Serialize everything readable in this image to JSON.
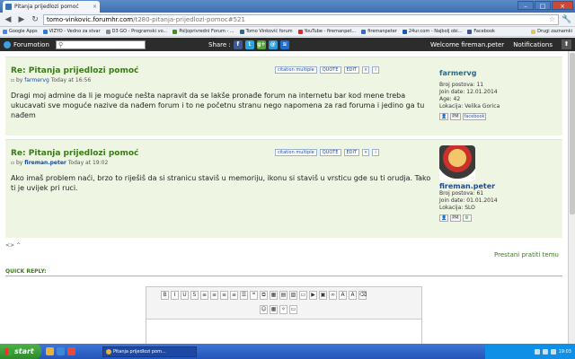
{
  "browser": {
    "tab_title": "Pitanja prijedlozi pomoć",
    "tab_close": "×",
    "controls": {
      "minimize": "–",
      "maximize": "□",
      "close": "×"
    },
    "nav": {
      "back": "◀",
      "forward": "▶",
      "reload": "↻"
    },
    "url_host": "tomo-vinkovic.forumhr.com",
    "url_path": "/t280-pitanja-prijedlozi-pomoc#521",
    "star": "☆",
    "wrench": "🔧"
  },
  "bookmarks": [
    {
      "label": "Google Apps",
      "color": "#4285f4"
    },
    {
      "label": "VIZYO - Vedno za stvar",
      "color": "#2f7bd6"
    },
    {
      "label": "D3 GO - Programski vo...",
      "color": "#888888"
    },
    {
      "label": "Poljoprivredni Forum - ...",
      "color": "#4a8a2a"
    },
    {
      "label": "Tomo Vinković forum",
      "color": "#2a6a8a"
    },
    {
      "label": "YouTube - firemanpet...",
      "color": "#d92b2b"
    },
    {
      "label": "firemanpeter",
      "color": "#3a6ac8"
    },
    {
      "label": "24ur.com - Najbolj obi...",
      "color": "#1a5ab0"
    },
    {
      "label": "Facebook",
      "color": "#3b5998"
    }
  ],
  "bookmarks_other": "Drugi zaznamki",
  "forumotion": {
    "logo": "Forumotion",
    "search_icon": "⚲",
    "share_label": "Share :",
    "welcome": "Welcome fireman.peter",
    "notifications": "Notifications",
    "up_arrow": "⬆"
  },
  "social": [
    {
      "name": "facebook-icon",
      "glyph": "f",
      "color": "#3b5998"
    },
    {
      "name": "twitter-icon",
      "glyph": "t",
      "color": "#28a6e0"
    },
    {
      "name": "google-plus-icon",
      "glyph": "g+",
      "color": "#56a53a"
    },
    {
      "name": "email-icon",
      "glyph": "@",
      "color": "#2c9ad6"
    },
    {
      "name": "rss-icon",
      "glyph": "≋",
      "color": "#1b6ed6"
    }
  ],
  "post_buttons": {
    "citation": "citation multiple",
    "quote": "QUOTE",
    "edit": "EDIT",
    "delete": "×",
    "ip": "i"
  },
  "posts": [
    {
      "title": "Re: Pitanja prijedlozi pomoć",
      "by": "by",
      "author": "farmervg",
      "date": "Today at 16:56",
      "body": "Dragi moj admine da li je moguće nešta napravit da se lakše pronađe forum na internetu bar kod mene treba ukucavati sve moguće nazive da nađem forum i to ne početnu stranu nego napomena za rad foruma i jedino ga tu nađem",
      "profile": {
        "name": "farmervg",
        "lines": [
          "Broj postova: 11",
          "Join date: 12.01.2014",
          "Age: 42",
          "Lokacija: Velika Gorica"
        ],
        "icons": [
          "👤",
          "PM",
          "facebook"
        ]
      }
    },
    {
      "title": "Re: Pitanja prijedlozi pomoć",
      "by": "by",
      "author": "fireman.peter",
      "date": "Today at 19:02",
      "body": "Ako imaš problem naći, brzo to riješiš da si stranicu staviš u memoriju, ikonu si staviš u vrsticu gde su ti orudja. Tako ti je uvijek pri ruci.",
      "profile": {
        "name": "fireman.peter",
        "lines": [
          "Broj postova: 61",
          "Join date: 01.01.2014",
          "Lokacija: SLO"
        ],
        "icons": [
          "👤",
          "PM",
          "⚙"
        ]
      }
    }
  ],
  "nav_arrows": "<> ^",
  "stop_watching": "Prestani pratiti temu",
  "quick_reply": "QUICK REPLY:",
  "editor_row1": [
    "B",
    "I",
    "U",
    "S",
    "≡",
    "≡",
    "≡",
    "≡",
    "☰",
    "❝",
    "⧉",
    "▦",
    "▤",
    "▧",
    "▭",
    "▶",
    "▣",
    "∞",
    "A",
    "A",
    "⌫"
  ],
  "editor_row2": [
    "☺",
    "▦",
    "✧",
    "▭"
  ],
  "taskbar": {
    "start": "start",
    "window": "Pitanja prijedlozi pom...",
    "clock": "19:03"
  }
}
